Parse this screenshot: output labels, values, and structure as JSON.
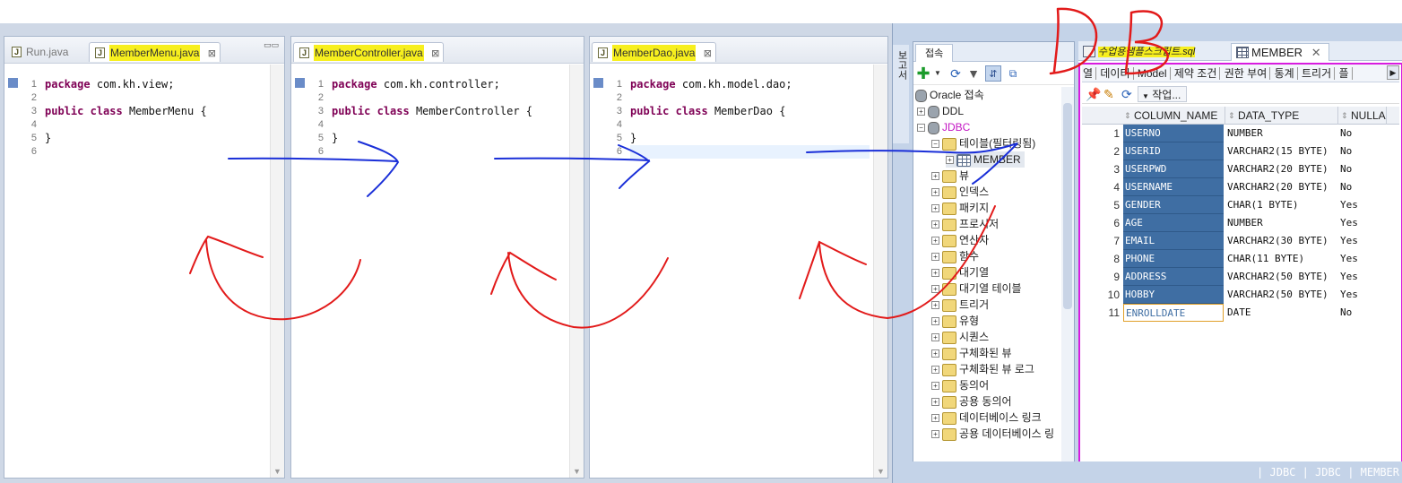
{
  "editors": [
    {
      "tabs": [
        {
          "label": "Run.java",
          "active": false,
          "highlighted": false
        },
        {
          "label": "MemberMenu.java",
          "active": true,
          "highlighted": true
        }
      ],
      "lines": [
        "package com.kh.view;",
        "",
        "public class MemberMenu {",
        "",
        "}",
        ""
      ],
      "line_numbers": [
        "1",
        "2",
        "3",
        "4",
        "5",
        "6"
      ]
    },
    {
      "tabs": [
        {
          "label": "MemberController.java",
          "active": true,
          "highlighted": true
        }
      ],
      "lines": [
        "package com.kh.controller;",
        "",
        "public class MemberController {",
        "",
        "}",
        ""
      ],
      "line_numbers": [
        "1",
        "2",
        "3",
        "4",
        "5",
        "6"
      ]
    },
    {
      "tabs": [
        {
          "label": "MemberDao.java",
          "active": true,
          "highlighted": true
        }
      ],
      "lines": [
        "package com.kh.model.dao;",
        "",
        "public class MemberDao {",
        "",
        "}",
        ""
      ],
      "line_numbers": [
        "1",
        "2",
        "3",
        "4",
        "5",
        "6"
      ]
    }
  ],
  "sqldev": {
    "left_strip_label": "보고서",
    "connections_tab": "접속",
    "tree": {
      "root": "Oracle 접속",
      "nodes": [
        {
          "label": "DDL",
          "icon": "db-icon"
        },
        {
          "label": "JDBC",
          "icon": "db-icon"
        },
        {
          "label": "테이블(필터링됨)",
          "icon": "folder-icon"
        },
        {
          "label": "MEMBER",
          "icon": "table-icon"
        },
        {
          "label": "뷰",
          "icon": "folder-icon"
        },
        {
          "label": "인덱스",
          "icon": "folder-icon"
        },
        {
          "label": "패키지",
          "icon": "folder-icon"
        },
        {
          "label": "프로시저",
          "icon": "folder-icon"
        },
        {
          "label": "연산자",
          "icon": "folder-icon"
        },
        {
          "label": "함수",
          "icon": "folder-icon"
        },
        {
          "label": "대기열",
          "icon": "folder-icon"
        },
        {
          "label": "대기열 테이블",
          "icon": "folder-icon"
        },
        {
          "label": "트리거",
          "icon": "folder-icon"
        },
        {
          "label": "유형",
          "icon": "folder-icon"
        },
        {
          "label": "시퀀스",
          "icon": "folder-icon"
        },
        {
          "label": "구체화된 뷰",
          "icon": "folder-icon"
        },
        {
          "label": "구체화된 뷰 로그",
          "icon": "folder-icon"
        },
        {
          "label": "동의어",
          "icon": "folder-icon"
        },
        {
          "label": "공용 동의어",
          "icon": "folder-icon"
        },
        {
          "label": "데이터베이스 링크",
          "icon": "folder-icon"
        },
        {
          "label": "공용 데이터베이스 링",
          "icon": "folder-icon"
        }
      ]
    },
    "doc_tabs": [
      {
        "label": "수업용샘플스크립트.sql",
        "highlighted": true
      },
      {
        "label": "MEMBER",
        "active": true
      }
    ],
    "sub_tabs": [
      "열",
      "데이터",
      "Model",
      "제약 조건",
      "권한 부여",
      "통계",
      "트리거",
      "플"
    ],
    "action_button": "작업...",
    "columns": {
      "col1": "COLUMN_NAME",
      "col2": "DATA_TYPE",
      "col3": "NULLA"
    },
    "rows": [
      {
        "n": "1",
        "name": "USERNO",
        "type": "NUMBER",
        "nullable": "No"
      },
      {
        "n": "2",
        "name": "USERID",
        "type": "VARCHAR2(15 BYTE)",
        "nullable": "No"
      },
      {
        "n": "3",
        "name": "USERPWD",
        "type": "VARCHAR2(20 BYTE)",
        "nullable": "No"
      },
      {
        "n": "4",
        "name": "USERNAME",
        "type": "VARCHAR2(20 BYTE)",
        "nullable": "No"
      },
      {
        "n": "5",
        "name": "GENDER",
        "type": "CHAR(1 BYTE)",
        "nullable": "Yes"
      },
      {
        "n": "6",
        "name": "AGE",
        "type": "NUMBER",
        "nullable": "Yes"
      },
      {
        "n": "7",
        "name": "EMAIL",
        "type": "VARCHAR2(30 BYTE)",
        "nullable": "Yes"
      },
      {
        "n": "8",
        "name": "PHONE",
        "type": "CHAR(11 BYTE)",
        "nullable": "Yes"
      },
      {
        "n": "9",
        "name": "ADDRESS",
        "type": "VARCHAR2(50 BYTE)",
        "nullable": "Yes"
      },
      {
        "n": "10",
        "name": "HOBBY",
        "type": "VARCHAR2(50 BYTE)",
        "nullable": "Yes"
      },
      {
        "n": "11",
        "name": "ENROLLDATE",
        "type": "DATE",
        "nullable": "No"
      }
    ],
    "status": "| JDBC | JDBC | MEMBER"
  },
  "annotation": {
    "text": "DB"
  },
  "colors": {
    "highlight_yellow": "#f7ef1e",
    "blue_ink": "#1a2fd8",
    "red_ink": "#e21a1a",
    "magenta_frame": "#d81ce0",
    "column_selected_bg": "#3f6ea3"
  }
}
